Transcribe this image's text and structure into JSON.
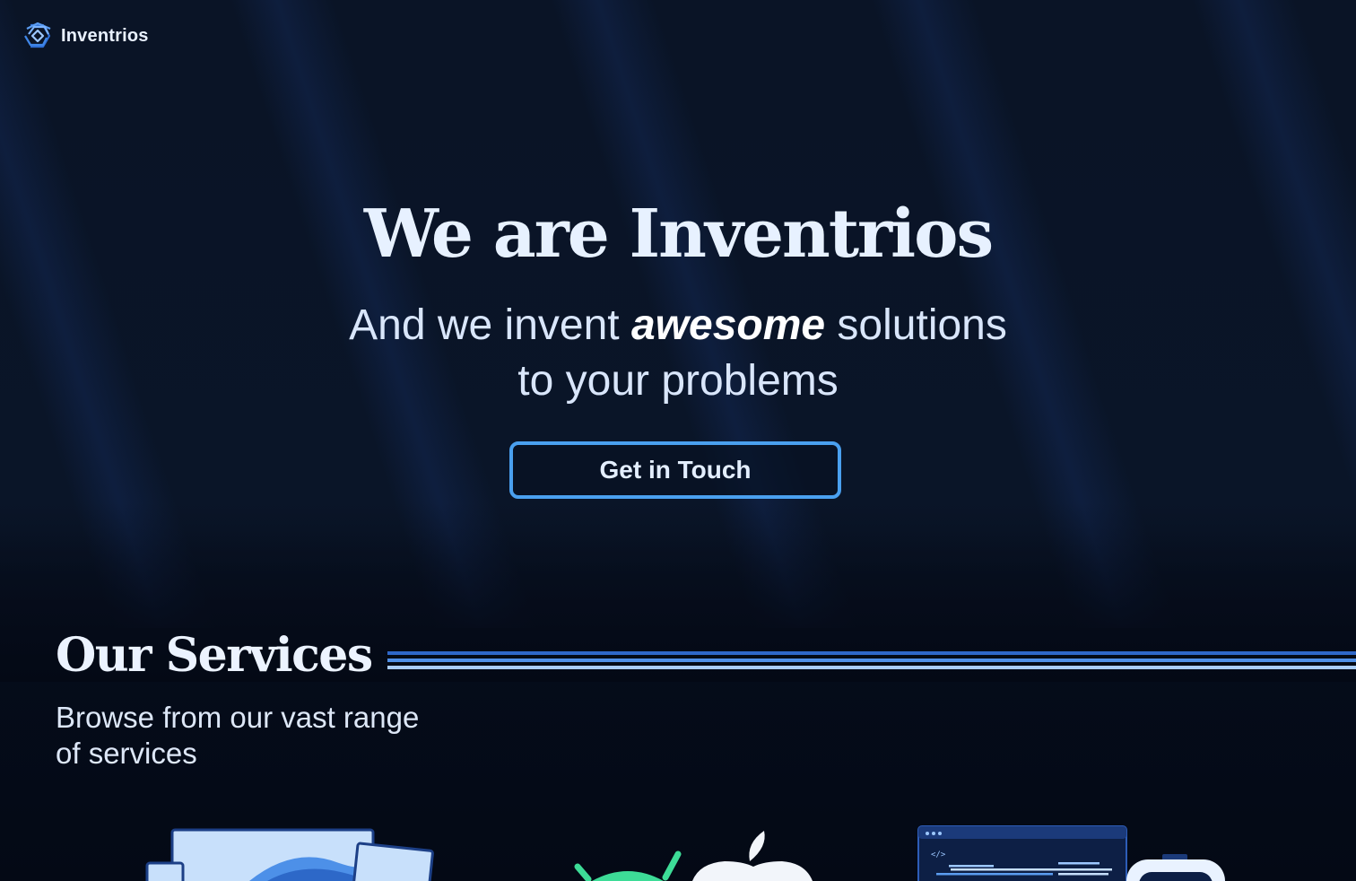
{
  "brand": {
    "name": "Inventrios"
  },
  "hero": {
    "title": "We are Inventrios",
    "subtitle_part1": "And we invent ",
    "subtitle_emphasis": "awesome",
    "subtitle_part2": " solutions",
    "subtitle_line2": "to your problems",
    "cta_label": "Get in Touch"
  },
  "services": {
    "title": "Our Services",
    "subtitle": "Browse from our vast range of services",
    "illustrations": [
      "web-design-devices-illustration",
      "mobile-platforms-illustration",
      "code-window-illustration"
    ]
  },
  "colors": {
    "background": "#071022",
    "accent": "#4aa0ef",
    "heading": "#e7f1ff",
    "android_green": "#3ddc97"
  }
}
